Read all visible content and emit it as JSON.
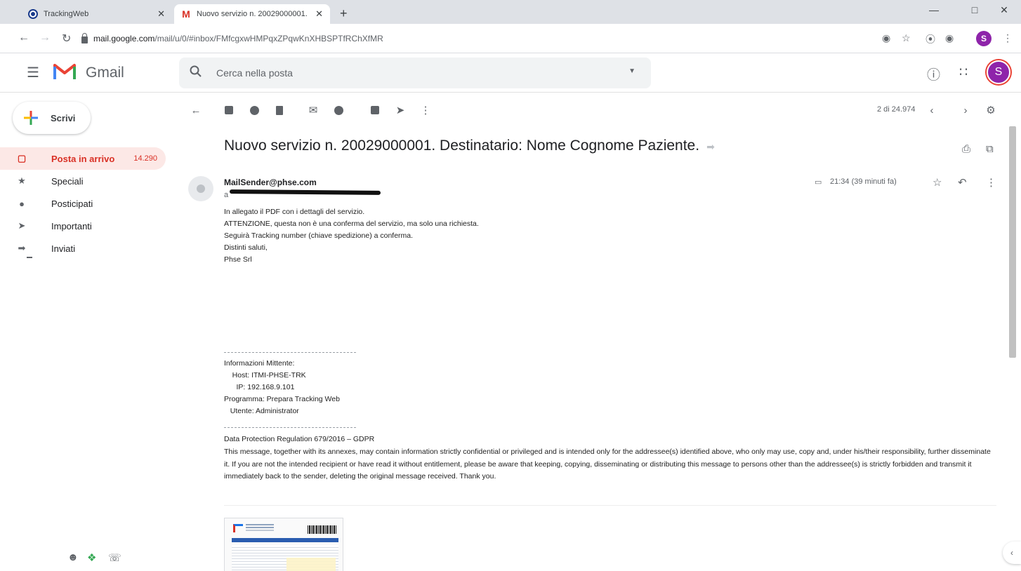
{
  "browser": {
    "tabs": [
      {
        "title": "TrackingWeb",
        "close": "✕"
      },
      {
        "title": "Nuovo servizio n. 20029000001.",
        "close": "✕"
      }
    ],
    "new_tab": "+",
    "url_domain": "mail.google.com",
    "url_path": "/mail/u/0/#inbox/FMfcgxwHMPqxZPqwKnXHBSPTfRChXfMR",
    "profile_initial": "S"
  },
  "gmail": {
    "brand": "Gmail",
    "search_placeholder": "Cerca nella posta",
    "account_initial": "S"
  },
  "sidebar": {
    "compose_label": "Scrivi",
    "items": [
      {
        "label": "Posta in arrivo",
        "count": "14.290",
        "icon": "inbox-icon"
      },
      {
        "label": "Speciali",
        "count": "",
        "icon": "star-icon"
      },
      {
        "label": "Posticipati",
        "count": "",
        "icon": "clock-icon"
      },
      {
        "label": "Importanti",
        "count": "",
        "icon": "label-important-icon"
      },
      {
        "label": "Inviati",
        "count": "",
        "icon": "send-icon"
      }
    ]
  },
  "toolbar": {
    "pager": "2 di 24.974"
  },
  "message": {
    "subject": "Nuovo servizio n. 20029000001. Destinatario: Nome Cognome Paziente.",
    "sender": "MailSender@phse.com",
    "to_prefix": "a",
    "time": "21:34 (39 minuti fa)",
    "body_lines_1": [
      "In allegato il PDF con i dettagli del servizio.",
      "",
      "ATTENZIONE, questa non è una conferma del servizio, ma solo una richiesta.",
      "Seguirà Tracking number (chiave spedizione) a conferma.",
      "",
      "Distinti saluti,",
      "Phse Srl"
    ],
    "info_lines": [
      "Informazioni Mittente:",
      "    Host: ITMI-PHSE-TRK",
      "      IP: 192.168.9.101",
      "Programma: Prepara Tracking Web",
      "   Utente: Administrator"
    ],
    "gdpr_title": "Data Protection Regulation 679/2016 – GDPR",
    "disclaimer": "This message, together with its annexes, may contain information strictly confidential or privileged and is intended only for the addressee(s) identified above, who only may use, copy and, under his/their responsibility, further disseminate it. If you are not the intended recipient or have read it without entitlement, please be aware that keeping, copying, disseminating or distributing this message to persons other than the addressee(s) is strictly forbidden and transmit it immediately back to the sender, deleting the original message received. Thank you."
  },
  "colors": {
    "accent_red": "#d93025",
    "active_bg": "#fce8e6",
    "avatar_purple": "#8e24aa"
  }
}
